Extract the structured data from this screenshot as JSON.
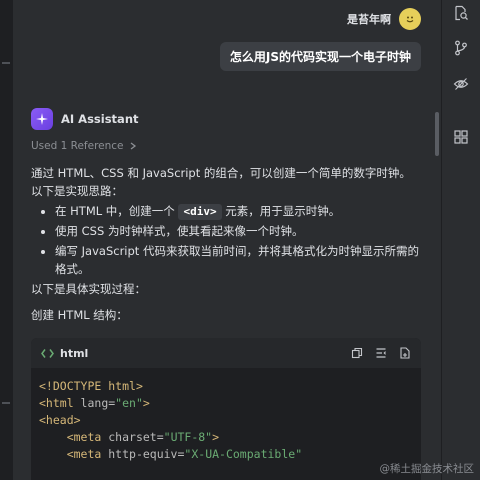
{
  "user": {
    "name": "是苔年啊",
    "question": "怎么用JS的代码实现一个电子时钟"
  },
  "assistant": {
    "name": "AI Assistant",
    "reference": "Used 1 Reference",
    "intro_1": "通过 HTML、CSS 和 JavaScript 的组合，可以创建一个简单的数字时钟。",
    "intro_2": "以下是实现思路：",
    "bullets": [
      {
        "pre": "在 HTML 中，创建一个 ",
        "code": "<div>",
        "post": " 元素，用于显示时钟。"
      },
      {
        "text": "使用 CSS 为时钟样式，使其看起来像一个时钟。"
      },
      {
        "text": "编写 JavaScript 代码来获取当前时间，并将其格式化为时钟显示所需的格式。"
      }
    ],
    "process_label": "以下是具体实现过程：",
    "step_label": "创建 HTML 结构："
  },
  "code_block": {
    "lang_icon": "code-brackets-icon",
    "lang": "html",
    "lines": {
      "l1_a": "<!DOCTYPE ",
      "l1_b": "html",
      "l1_c": ">",
      "l2_a": "<html ",
      "l2_b": "lang=",
      "l2_c": "\"en\"",
      "l2_d": ">",
      "l3": "<head>",
      "l4_a": "<meta ",
      "l4_b": "charset=",
      "l4_c": "\"UTF-8\"",
      "l4_d": ">",
      "l5_a": "<meta ",
      "l5_b": "http-equiv=",
      "l5_c": "\"X-UA-Compatible\""
    }
  },
  "right_toolbar": [
    "search-file-icon",
    "git-branch-icon",
    "eye-icon",
    "grid-icon"
  ],
  "watermark": "@稀土掘金技术社区",
  "colors": {
    "accent": "#8a5cf6",
    "avatar": "#e6cf5a",
    "background": "#2b2d30",
    "code_bg": "#1e1f22"
  }
}
